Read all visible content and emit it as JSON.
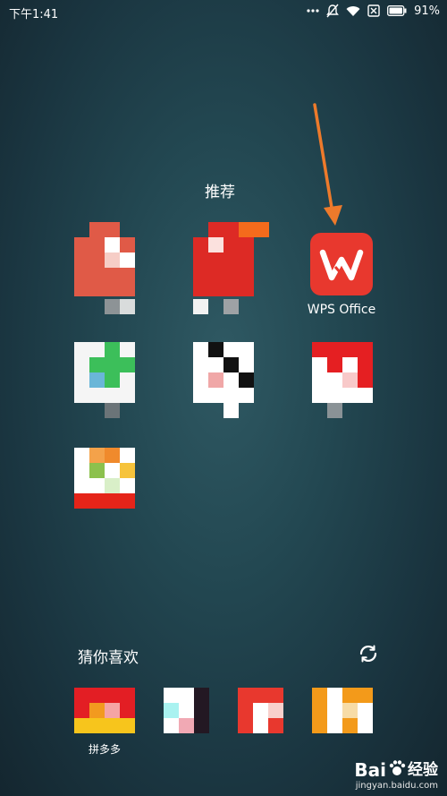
{
  "status_bar": {
    "time": "下午1:41",
    "battery_percent": "91%",
    "icons": [
      "dots-icon",
      "mute-icon",
      "wifi-icon",
      "sim-off-icon",
      "battery-icon"
    ]
  },
  "recommend": {
    "title": "推荐",
    "apps": [
      {
        "name": "",
        "label": ""
      },
      {
        "name": "",
        "label": ""
      },
      {
        "name": "wps-office",
        "label": "WPS Office",
        "accent": "#e8382e"
      },
      {
        "name": "",
        "label": ""
      },
      {
        "name": "",
        "label": ""
      },
      {
        "name": "",
        "label": ""
      },
      {
        "name": "",
        "label": ""
      }
    ]
  },
  "guess": {
    "title": "猜你喜欢",
    "refresh_icon": "refresh-icon",
    "apps": [
      {
        "label": "拼多多"
      },
      {
        "label": ""
      },
      {
        "label": ""
      },
      {
        "label": ""
      }
    ]
  },
  "watermark": {
    "logo": "Bai",
    "logo_tail": "经验",
    "url": "jingyan.baidu.com"
  },
  "annotation": {
    "type": "arrow",
    "color": "#ee7a2b"
  }
}
